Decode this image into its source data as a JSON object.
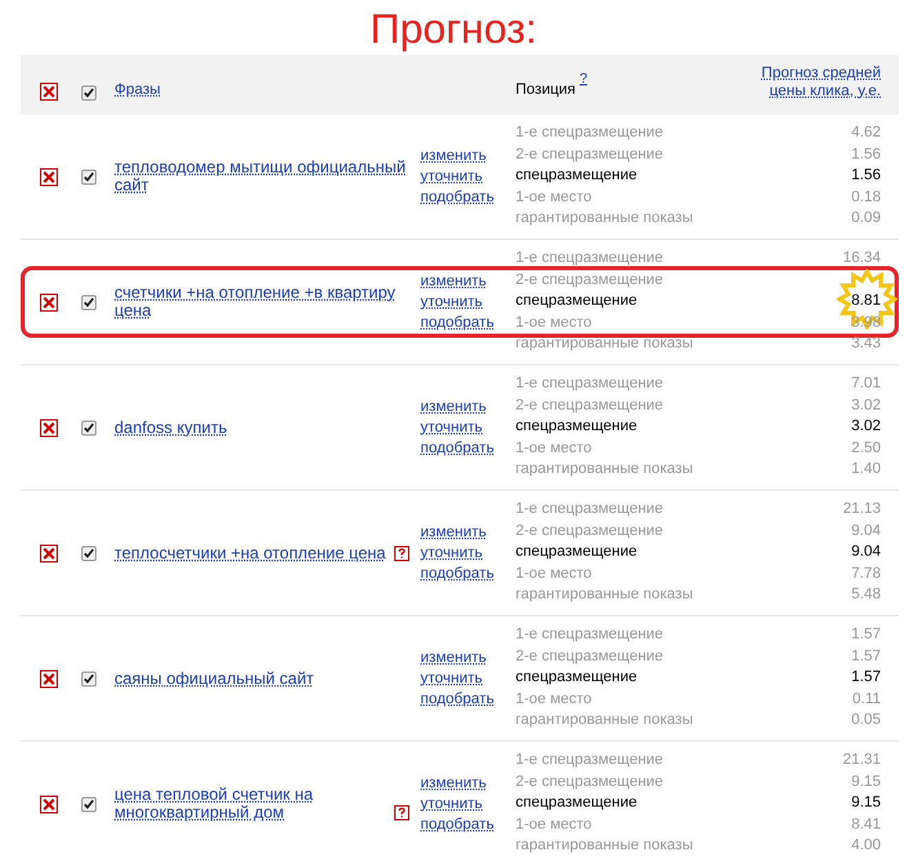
{
  "title": "Прогноз:",
  "header": {
    "checked": true,
    "phrases": "Фразы",
    "position": "Позиция",
    "position_help": "?",
    "price": "Прогноз средней цены клика, у.е."
  },
  "rows": [
    {
      "phrase": "тепловодомер мытищи официальный сайт",
      "help": false,
      "highlighted": false,
      "checked": true,
      "actions": [
        "изменить",
        "уточнить",
        "подобрать"
      ],
      "positions": [
        {
          "label": "1-е спецразмещение",
          "value": "4.62",
          "selected": false
        },
        {
          "label": "2-е спецразмещение",
          "value": "1.56",
          "selected": false
        },
        {
          "label": "спецразмещение",
          "value": "1.56",
          "selected": true
        },
        {
          "label": "1-ое место",
          "value": "0.18",
          "selected": false
        },
        {
          "label": "гарантированные показы",
          "value": "0.09",
          "selected": false
        }
      ]
    },
    {
      "phrase": "счетчики +на отопление +в квартиру цена",
      "help": false,
      "highlighted": true,
      "checked": true,
      "actions": [
        "изменить",
        "уточнить",
        "подобрать"
      ],
      "positions": [
        {
          "label": "1-е спецразмещение",
          "value": "16.34",
          "selected": false
        },
        {
          "label": "2-е спецразмещение",
          "selected": false
        },
        {
          "label": "спецразмещение",
          "value": "8.81",
          "selected": true
        },
        {
          "label": "1-ое место",
          "value": "3.98",
          "selected": false
        },
        {
          "label": "гарантированные показы",
          "value": "3.43",
          "selected": false
        }
      ]
    },
    {
      "phrase": "danfoss купить",
      "help": false,
      "highlighted": false,
      "checked": true,
      "actions": [
        "изменить",
        "уточнить",
        "подобрать"
      ],
      "positions": [
        {
          "label": "1-е спецразмещение",
          "value": "7.01",
          "selected": false
        },
        {
          "label": "2-е спецразмещение",
          "value": "3.02",
          "selected": false
        },
        {
          "label": "спецразмещение",
          "value": "3.02",
          "selected": true
        },
        {
          "label": "1-ое место",
          "value": "2.50",
          "selected": false
        },
        {
          "label": "гарантированные показы",
          "value": "1.40",
          "selected": false
        }
      ]
    },
    {
      "phrase": "теплосчетчики +на отопление цена",
      "help": true,
      "highlighted": false,
      "checked": true,
      "actions": [
        "изменить",
        "уточнить",
        "подобрать"
      ],
      "positions": [
        {
          "label": "1-е спецразмещение",
          "value": "21.13",
          "selected": false
        },
        {
          "label": "2-е спецразмещение",
          "value": "9.04",
          "selected": false
        },
        {
          "label": "спецразмещение",
          "value": "9.04",
          "selected": true
        },
        {
          "label": "1-ое место",
          "value": "7.78",
          "selected": false
        },
        {
          "label": "гарантированные показы",
          "value": "5.48",
          "selected": false
        }
      ]
    },
    {
      "phrase": "саяны официальный сайт",
      "help": false,
      "highlighted": false,
      "checked": true,
      "actions": [
        "изменить",
        "уточнить",
        "подобрать"
      ],
      "positions": [
        {
          "label": "1-е спецразмещение",
          "value": "1.57",
          "selected": false
        },
        {
          "label": "2-е спецразмещение",
          "value": "1.57",
          "selected": false
        },
        {
          "label": "спецразмещение",
          "value": "1.57",
          "selected": true
        },
        {
          "label": "1-ое место",
          "value": "0.11",
          "selected": false
        },
        {
          "label": "гарантированные показы",
          "value": "0.05",
          "selected": false
        }
      ]
    },
    {
      "phrase": "цена тепловой счетчик на многоквартирный дом",
      "help": true,
      "highlighted": false,
      "checked": true,
      "actions": [
        "изменить",
        "уточнить",
        "подобрать"
      ],
      "positions": [
        {
          "label": "1-е спецразмещение",
          "value": "21.31",
          "selected": false
        },
        {
          "label": "2-е спецразмещение",
          "value": "9.15",
          "selected": false
        },
        {
          "label": "спецразмещение",
          "value": "9.15",
          "selected": true
        },
        {
          "label": "1-ое место",
          "value": "8.41",
          "selected": false
        },
        {
          "label": "гарантированные показы",
          "value": "4.00",
          "selected": false
        }
      ]
    }
  ]
}
